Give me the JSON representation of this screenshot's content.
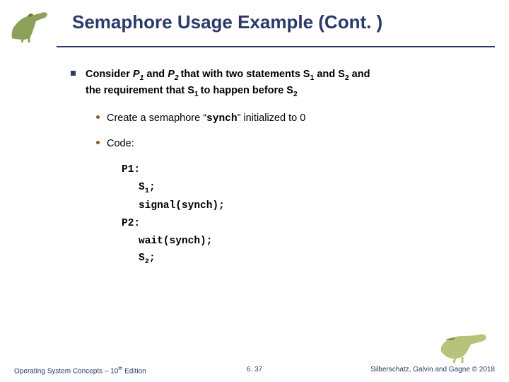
{
  "title": "Semaphore Usage Example (Cont. )",
  "main_line1": "Consider ",
  "main_p1": "P",
  "main_and1": " and ",
  "main_p2": "P",
  "main_rest1": " that with two statements S",
  "main_and2": " and S",
  "main_rest2": "  and",
  "main_line2a": "the requirement  that S",
  "main_line2b": " to happen before S",
  "sub1_a": "Create a semaphore “",
  "sub1_synch": "synch",
  "sub1_b": "” initialized to 0",
  "sub2": "Code:",
  "code": {
    "p1": "P1:",
    "s1": "S",
    "s1semi": ";",
    "signal": "signal(synch);",
    "p2": "P2:",
    "wait": "wait(synch);",
    "s2": "S",
    "s2semi": ";"
  },
  "footer": {
    "left_a": "Operating System Concepts – 10",
    "left_th": "th",
    "left_b": " Edition",
    "center": "6. 37",
    "right": "Silberschatz, Galvin and Gagne © 2018"
  }
}
